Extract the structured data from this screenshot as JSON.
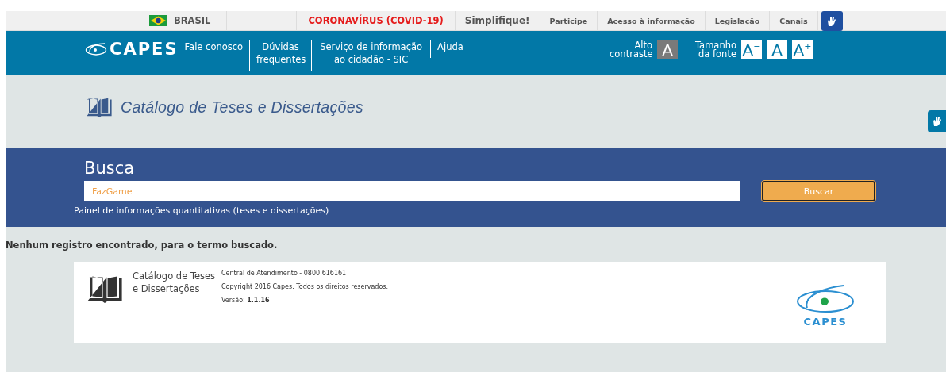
{
  "top_bar": {
    "country": "BRASIL",
    "links": [
      {
        "label": "CORONAVÍRUS (COVID-19)",
        "kind": "alert"
      },
      {
        "label": "Simplifique!",
        "kind": "featured"
      },
      {
        "label": "Participe",
        "kind": "normal"
      },
      {
        "label": "Acesso à informação",
        "kind": "normal"
      },
      {
        "label": "Legislação",
        "kind": "normal"
      },
      {
        "label": "Canais",
        "kind": "normal"
      }
    ]
  },
  "header": {
    "logo": "CAPES",
    "nav": [
      "Fale conosco",
      "Dúvidas frequentes",
      "Serviço de informação ao cidadão - SIC",
      "Ajuda"
    ],
    "contrast_label": "Alto contraste",
    "contrast_button": "A",
    "font_label": "Tamanho da fonte",
    "font_buttons": [
      "A$^{−}$",
      "A",
      "A$^{+}$"
    ]
  },
  "catalog_title": "Catálogo de Teses e Dissertações",
  "search": {
    "title": "Busca",
    "value": "FazGame",
    "button": "Buscar",
    "panel_link": "Painel de informações quantitativas (teses e dissertações)"
  },
  "message": "Nenhum registro encontrado, para o termo buscado.",
  "footer": {
    "title": "Catálogo de Teses e Dissertações",
    "contact": "Central de Atendimento - 0800 616161",
    "copyright": "Copyright 2016 Capes. Todos os direitos reservados.",
    "version": "Versão: **1.1.16**",
    "logo": "CAPES"
  }
}
